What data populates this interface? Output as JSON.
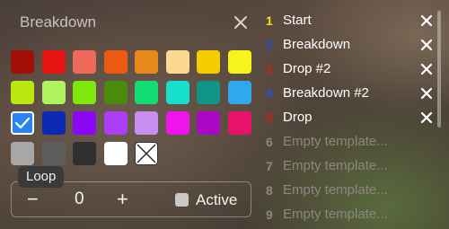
{
  "panel": {
    "title": "Breakdown"
  },
  "colors": [
    [
      "#a10f07",
      "#e81414",
      "#f06a5c",
      "#ec5a12",
      "#e88a1a",
      "#fcd991",
      "#f5cc00",
      "#f6f41c"
    ],
    [
      "#bce70e",
      "#aef25c",
      "#7ee70c",
      "#4a8a0c",
      "#12dc74",
      "#16dfca",
      "#0f9486",
      "#30a8ef"
    ],
    [
      "#2a84ee",
      "#0c2ab3",
      "#8a08f6",
      "#ac3ef4",
      "#c98ef2",
      "#f013ec",
      "#ab08c5",
      "#e8126a"
    ],
    [
      "#a7a7a7",
      "#5e5e5e",
      "#2f2f2f",
      "#ffffff",
      "none"
    ]
  ],
  "selected_color": "#2a84ee",
  "loop": {
    "tooltip": "Loop",
    "minus": "−",
    "value": "0",
    "plus": "+",
    "active_label": "Active",
    "active_checked": false
  },
  "templates": [
    {
      "num": "1",
      "label": "Start",
      "num_color": "#f2e20f",
      "empty": false
    },
    {
      "num": "2",
      "label": "Breakdown",
      "num_color": "#2a4fd6",
      "empty": false
    },
    {
      "num": "3",
      "label": "Drop #2",
      "num_color": "#c8231b",
      "empty": false
    },
    {
      "num": "4",
      "label": "Breakdown #2",
      "num_color": "#2a4fd6",
      "empty": false
    },
    {
      "num": "5",
      "label": "Drop",
      "num_color": "#c8231b",
      "empty": false
    },
    {
      "num": "6",
      "label": "Empty template...",
      "empty": true
    },
    {
      "num": "7",
      "label": "Empty template...",
      "empty": true
    },
    {
      "num": "8",
      "label": "Empty template...",
      "empty": true
    },
    {
      "num": "9",
      "label": "Empty template...",
      "empty": true
    }
  ]
}
